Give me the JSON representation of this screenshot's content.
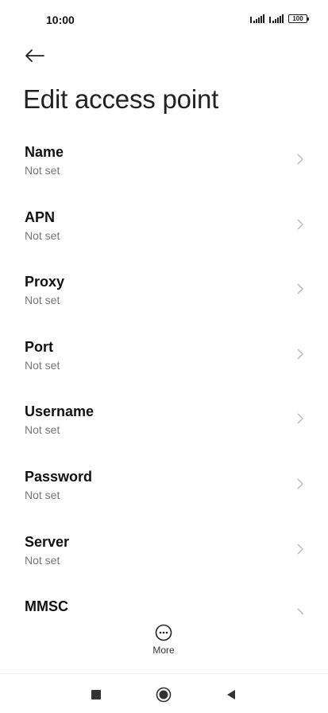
{
  "status_bar": {
    "time": "10:00",
    "battery": "100",
    "icons": [
      "signal-icon",
      "signal-icon",
      "battery-icon"
    ]
  },
  "header": {
    "back_icon": "back-arrow-icon",
    "title": "Edit access point"
  },
  "settings": [
    {
      "label": "Name",
      "value": "Not set"
    },
    {
      "label": "APN",
      "value": "Not set"
    },
    {
      "label": "Proxy",
      "value": "Not set"
    },
    {
      "label": "Port",
      "value": "Not set"
    },
    {
      "label": "Username",
      "value": "Not set"
    },
    {
      "label": "Password",
      "value": "Not set"
    },
    {
      "label": "Server",
      "value": "Not set"
    },
    {
      "label": "MMSC",
      "value": ""
    }
  ],
  "bottom_action": {
    "icon": "more-icon",
    "label": "More"
  },
  "nav_bar": {
    "icons": [
      "recents-square-icon",
      "home-circle-icon",
      "back-triangle-icon"
    ]
  }
}
